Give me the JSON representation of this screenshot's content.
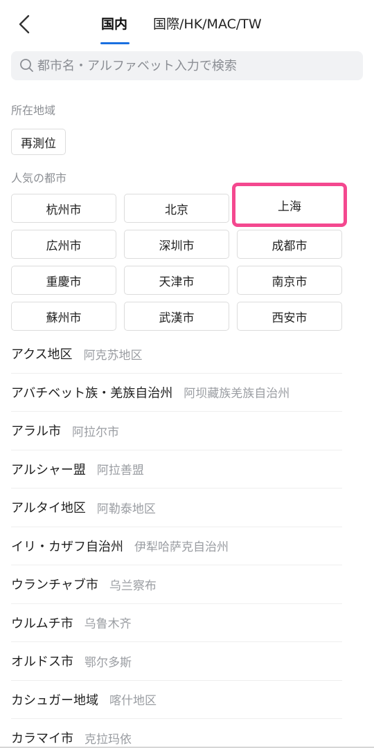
{
  "header": {
    "back_icon": "chevron-left-icon",
    "tabs": [
      {
        "label": "国内",
        "active": true
      },
      {
        "label": "国際/HK/MAC/TW",
        "active": false
      }
    ],
    "accent_color": "#1a6fe0"
  },
  "search": {
    "icon": "search-icon",
    "placeholder": "都市名・アルファベット入力で検索"
  },
  "location_section": {
    "title": "所在地域",
    "relocate_label": "再測位"
  },
  "popular_section": {
    "title": "人気の都市",
    "cities": [
      "杭州市",
      "北京",
      "上海",
      "広州市",
      "深圳市",
      "成都市",
      "重慶市",
      "天津市",
      "南京市",
      "蘇州市",
      "武漢市",
      "西安市"
    ],
    "highlighted_city": "上海",
    "highlight_color": "#f4488f"
  },
  "city_list": [
    {
      "jp": "アクス地区",
      "cn": "阿克苏地区"
    },
    {
      "jp": "アバチベット族・羌族自治州",
      "cn": "阿坝藏族羌族自治州"
    },
    {
      "jp": "アラル市",
      "cn": "阿拉尔市"
    },
    {
      "jp": "アルシャー盟",
      "cn": "阿拉善盟"
    },
    {
      "jp": "アルタイ地区",
      "cn": "阿勒泰地区"
    },
    {
      "jp": "イリ・カザフ自治州",
      "cn": "伊犁哈萨克自治州"
    },
    {
      "jp": "ウランチャブ市",
      "cn": "乌兰察布"
    },
    {
      "jp": "ウルムチ市",
      "cn": "乌鲁木齐"
    },
    {
      "jp": "オルドス市",
      "cn": "鄂尔多斯"
    },
    {
      "jp": "カシュガー地域",
      "cn": "喀什地区"
    },
    {
      "jp": "カラマイ市",
      "cn": "克拉玛依"
    }
  ]
}
